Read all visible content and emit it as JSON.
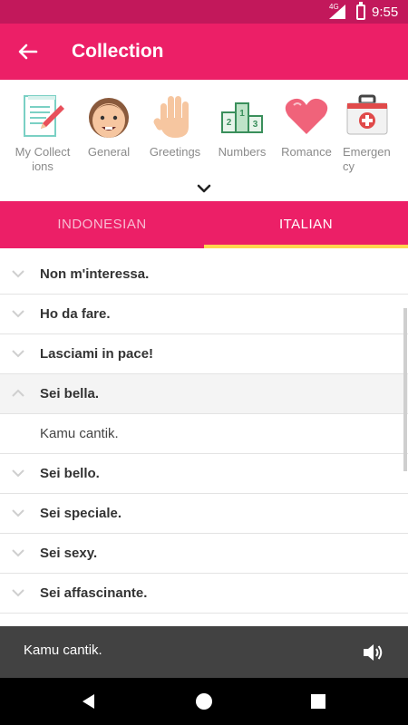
{
  "status_bar": {
    "network": "4G",
    "time": "9:55"
  },
  "app_bar": {
    "title": "Collection",
    "back_icon": "arrow-left-icon"
  },
  "categories": [
    {
      "label": "My Collect ions",
      "icon": "notepad-pencil-icon"
    },
    {
      "label": "General",
      "icon": "smiling-face-icon"
    },
    {
      "label": "Greetings",
      "icon": "waving-hand-icon"
    },
    {
      "label": "Numbers",
      "icon": "podium-icon"
    },
    {
      "label": "Romance",
      "icon": "heart-icon"
    },
    {
      "label": "Emergen cy",
      "icon": "first-aid-kit-icon"
    }
  ],
  "tabs": [
    {
      "label": "INDONESIAN",
      "active": false
    },
    {
      "label": "ITALIAN",
      "active": true
    }
  ],
  "phrases": [
    {
      "text": "Non m'interessa.",
      "expanded": false
    },
    {
      "text": "Ho da fare.",
      "expanded": false
    },
    {
      "text": "Lasciami in pace!",
      "expanded": false
    },
    {
      "text": "Sei bella.",
      "expanded": true,
      "translation": "Kamu cantik."
    },
    {
      "text": "Sei bello.",
      "expanded": false
    },
    {
      "text": "Sei speciale.",
      "expanded": false
    },
    {
      "text": "Sei sexy.",
      "expanded": false
    },
    {
      "text": "Sei affascinante.",
      "expanded": false
    }
  ],
  "player": {
    "text": "Kamu cantik.",
    "icon": "speaker-icon"
  },
  "colors": {
    "primary": "#ec1f67",
    "primary_dark": "#c2185b",
    "indicator": "#ffd54f"
  }
}
